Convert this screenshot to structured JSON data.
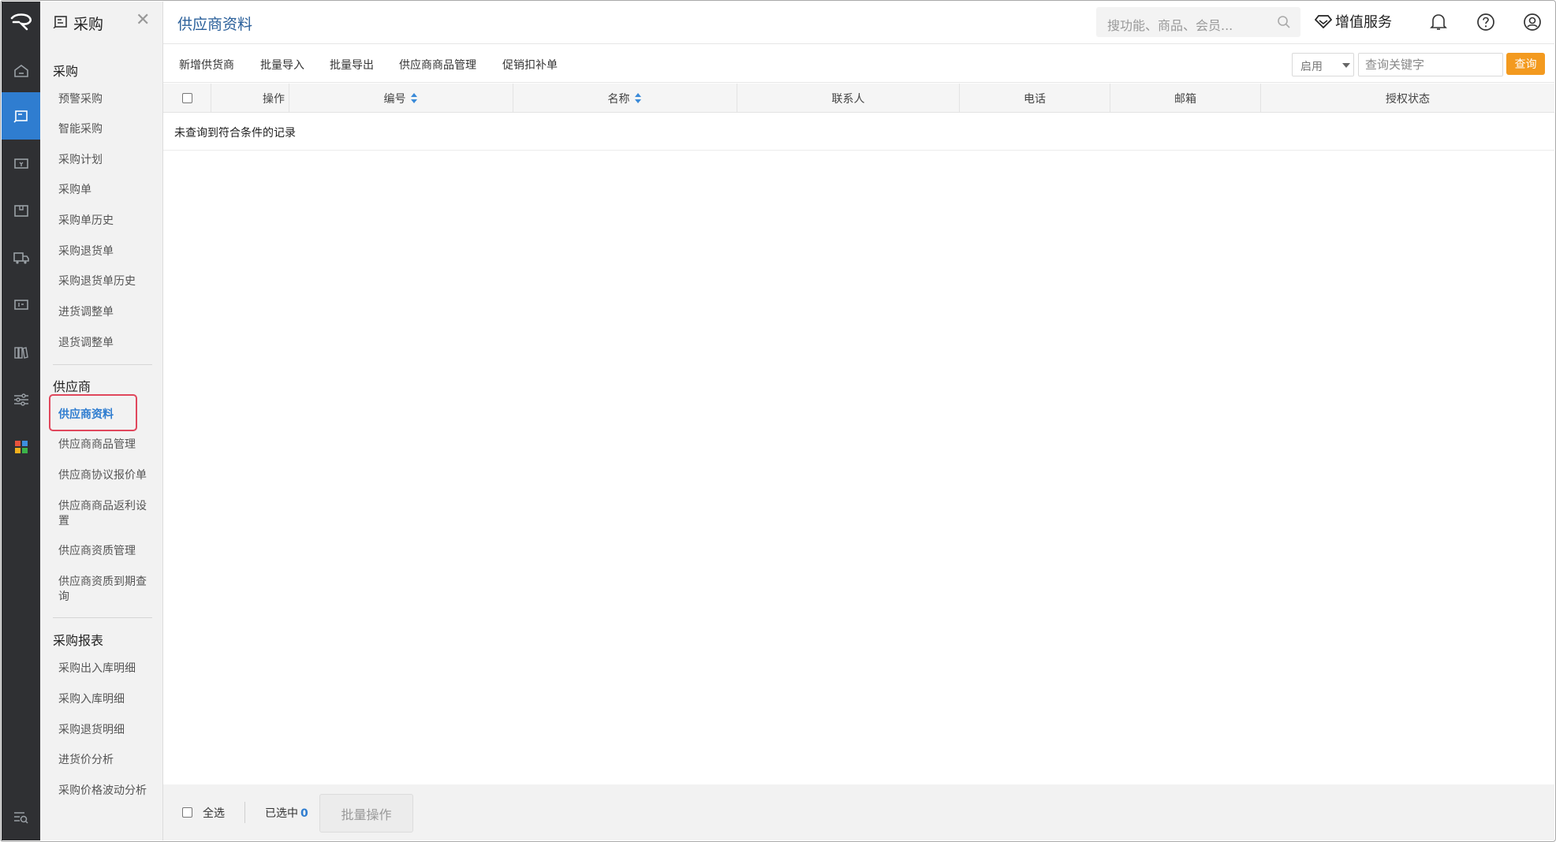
{
  "window": {
    "border_color": "#a9a9a9"
  },
  "rail": {
    "items": [
      "logo-icon",
      "home-icon",
      "purchase-icon",
      "finance-icon",
      "inventory-icon",
      "logistics-icon",
      "pos-icon",
      "books-icon",
      "settings-sliders-icon",
      "apps-grid-icon",
      "search-menu-icon"
    ],
    "active_color": "#2f7dd0"
  },
  "sidebar": {
    "title": "采购",
    "groups": [
      {
        "title": "采购",
        "items": [
          "预警采购",
          "智能采购",
          "采购计划",
          "采购单",
          "采购单历史",
          "采购退货单",
          "采购退货单历史",
          "进货调整单",
          "退货调整单"
        ]
      },
      {
        "title": "供应商",
        "items": [
          "供应商资料",
          "供应商商品管理",
          "供应商协议报价单",
          "供应商商品返利设置",
          "供应商资质管理",
          "供应商资质到期查询"
        ]
      },
      {
        "title": "采购报表",
        "items": [
          "采购出入库明细",
          "采购入库明细",
          "采购退货明细",
          "进货价分析",
          "采购价格波动分析"
        ]
      }
    ],
    "active_item": "供应商资料"
  },
  "header": {
    "page_title": "供应商资料",
    "search_placeholder": "搜功能、商品、会员...",
    "vip_label": "增值服务"
  },
  "toolbar": {
    "buttons": [
      "新增供货商",
      "批量导入",
      "批量导出",
      "供应商商品管理",
      "促销扣补单"
    ],
    "status_select": "启用",
    "keyword_placeholder": "查询关键字",
    "query_label": "查询",
    "query_color": "#f39a1f"
  },
  "table": {
    "columns": [
      "操作",
      "编号",
      "名称",
      "联系人",
      "电话",
      "邮箱",
      "授权状态"
    ],
    "sortable": [
      "编号",
      "名称"
    ],
    "empty_text": "未查询到符合条件的记录"
  },
  "footer": {
    "select_all": "全选",
    "selected_label": "已选中",
    "selected_count": "0",
    "batch_label": "批量操作"
  }
}
